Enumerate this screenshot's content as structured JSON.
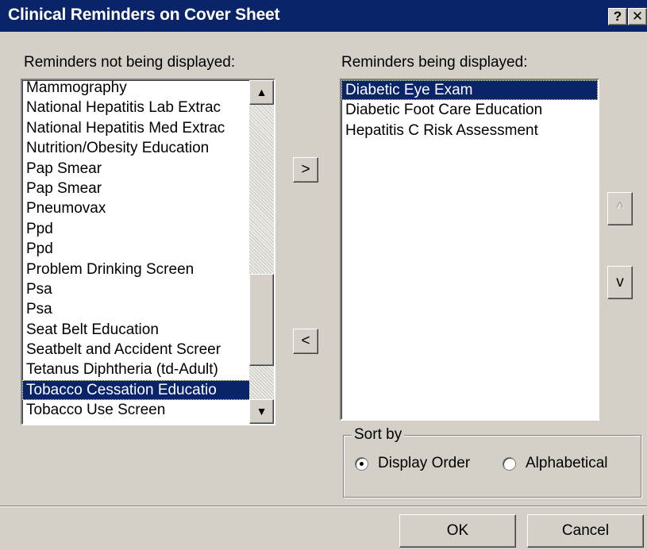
{
  "window": {
    "title": "Clinical Reminders on Cover Sheet",
    "help_glyph": "?",
    "close_glyph": "✕"
  },
  "left_panel": {
    "label": "Reminders not being displayed:",
    "items": [
      "Mammography",
      "National Hepatitis Lab Extrac",
      "National Hepatitis Med Extrac",
      "Nutrition/Obesity Education",
      "Pap Smear",
      "Pap Smear",
      "Pneumovax",
      "Ppd",
      "Ppd",
      "Problem Drinking Screen",
      "Psa",
      "Psa",
      "Seat Belt Education",
      "Seatbelt and Accident Screer",
      "Tetanus Diphtheria (td-Adult)",
      "Tobacco Cessation Educatio",
      "Tobacco Use Screen"
    ],
    "selected_index": 15
  },
  "right_panel": {
    "label": "Reminders being displayed:",
    "items": [
      "Diabetic Eye Exam",
      "Diabetic Foot Care Education",
      "Hepatitis C Risk Assessment"
    ],
    "selected_index": 0
  },
  "buttons": {
    "add": ">",
    "remove": "<",
    "move_up": "^",
    "move_down": "v",
    "ok": "OK",
    "cancel": "Cancel"
  },
  "sort_by": {
    "legend": "Sort by",
    "options": [
      "Display Order",
      "Alphabetical"
    ],
    "selected": "Display Order"
  },
  "scrollbar": {
    "up_glyph": "▲",
    "down_glyph": "▼"
  },
  "colors": {
    "face": "#d4d0c8",
    "title_bar": "#0a246a",
    "selection": "#0a246a"
  }
}
